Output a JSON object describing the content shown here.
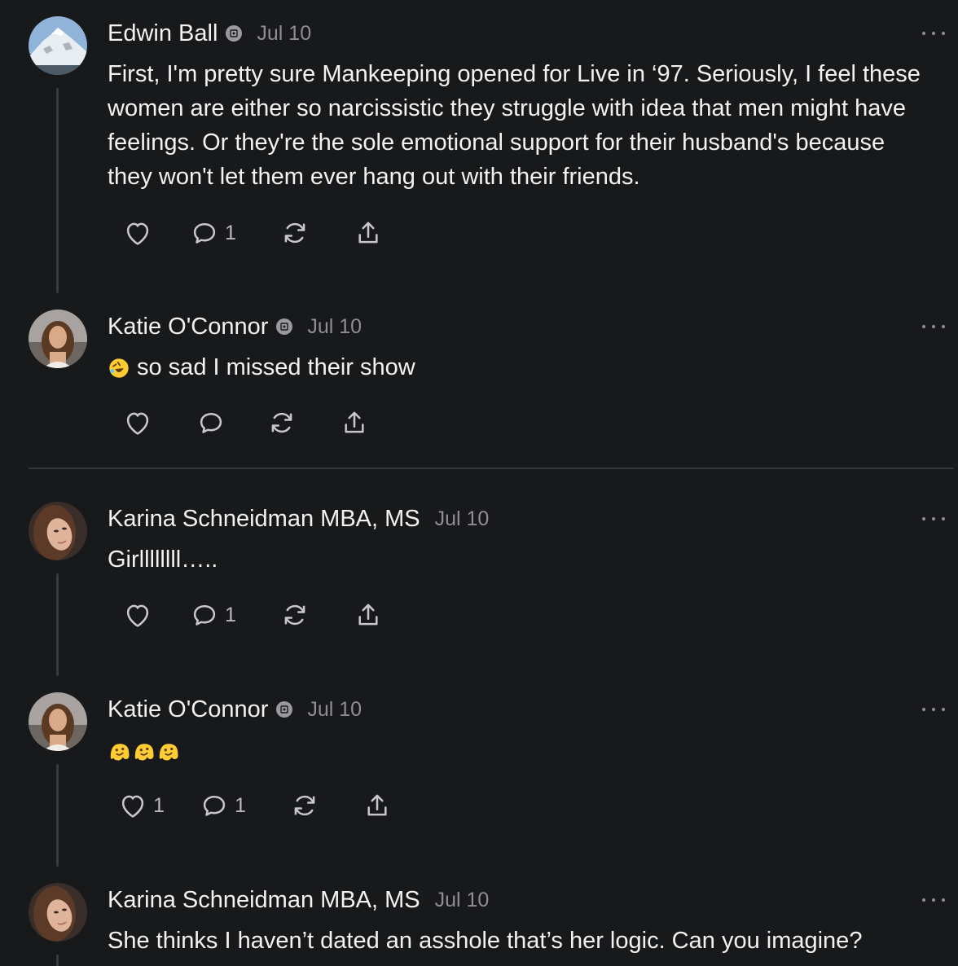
{
  "comments": [
    {
      "author": "Edwin Ball",
      "date": "Jul 10",
      "badge": true,
      "avatar_icon": "mountain-avatar",
      "text": "First, I'm pretty sure Mankeeping opened for Live in ‘97. Seriously, I feel these women are either so narcissistic they struggle with idea that men might have feelings. Or they're the sole emotional support for their husband's because they won't let them ever hang out with their friends.",
      "likes": "",
      "replies": "1"
    },
    {
      "author": "Katie O'Connor",
      "date": "Jul 10",
      "badge": true,
      "avatar_icon": "woman-avatar",
      "emoji": "rolling-on-floor-laughing-emoji",
      "text": "so sad I missed their show",
      "likes": "",
      "replies": ""
    },
    {
      "author": "Karina Schneidman MBA, MS",
      "date": "Jul 10",
      "badge": false,
      "avatar_icon": "woman-selfie-avatar",
      "text": "Girllllllll…..",
      "likes": "",
      "replies": "1"
    },
    {
      "author": "Katie O'Connor",
      "date": "Jul 10",
      "badge": true,
      "avatar_icon": "woman-avatar",
      "emoji": "melting-face-emoji",
      "emoji_count": 3,
      "text": "",
      "likes": "1",
      "replies": "1"
    },
    {
      "author": "Karina Schneidman MBA, MS",
      "date": "Jul 10",
      "badge": false,
      "avatar_icon": "woman-selfie-avatar",
      "text": "She thinks I haven’t dated an asshole that’s her logic. Can you imagine?",
      "likes": "",
      "replies": ""
    }
  ],
  "icons": {
    "like": "heart-icon",
    "reply": "speech-bubble-icon",
    "restack": "restack-icon",
    "share": "share-icon",
    "more": "more-dots-icon"
  },
  "colors": {
    "background": "#18191b",
    "text": "#f2f2f2",
    "muted": "#8e8e93",
    "icon": "#c7c7cc"
  }
}
